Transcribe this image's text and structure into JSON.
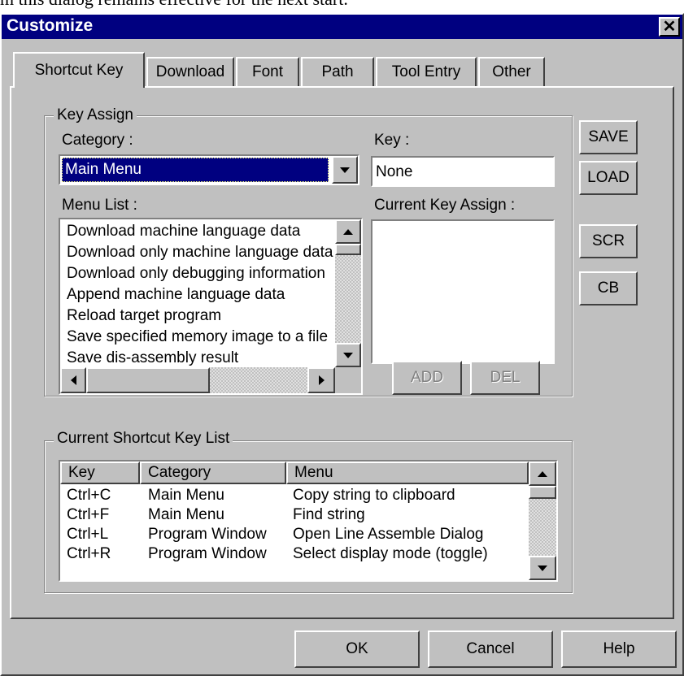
{
  "background_text": "m this dialog remains effective for the next start.",
  "window": {
    "title": "Customize",
    "close_glyph": "✕"
  },
  "tabs": [
    {
      "label": "Shortcut Key",
      "active": true
    },
    {
      "label": "Download"
    },
    {
      "label": "Font"
    },
    {
      "label": "Path"
    },
    {
      "label": "Tool Entry"
    },
    {
      "label": "Other"
    }
  ],
  "key_assign": {
    "legend": "Key Assign",
    "category_label": "Category :",
    "category_value": "Main Menu",
    "key_label": "Key :",
    "key_value": "None",
    "menu_list_label": "Menu List :",
    "menu_items": [
      "Download machine language data",
      "Download only machine language data",
      "Download only debugging information",
      "Append machine language data",
      "Reload target program",
      "Save specified memory image to a file",
      "Save dis-assembly result"
    ],
    "current_key_assign_label": "Current Key Assign :",
    "add_label": "ADD",
    "del_label": "DEL"
  },
  "side_buttons": {
    "save": "SAVE",
    "load": "LOAD",
    "scr": "SCR",
    "cb": "CB"
  },
  "shortcut_list": {
    "legend": "Current Shortcut Key List",
    "columns": [
      "Key",
      "Category",
      "Menu"
    ],
    "rows": [
      [
        "Ctrl+C",
        "Main Menu",
        "Copy string to clipboard"
      ],
      [
        "Ctrl+F",
        "Main Menu",
        "Find string"
      ],
      [
        "Ctrl+L",
        "Program Window",
        "Open Line Assemble Dialog"
      ],
      [
        "Ctrl+R",
        "Program Window",
        "Select display mode (toggle)"
      ]
    ]
  },
  "footer": {
    "ok": "OK",
    "cancel": "Cancel",
    "help": "Help"
  },
  "colors": {
    "face": "#c0c0c0",
    "title_bar": "#000080",
    "selection": "#000080"
  }
}
